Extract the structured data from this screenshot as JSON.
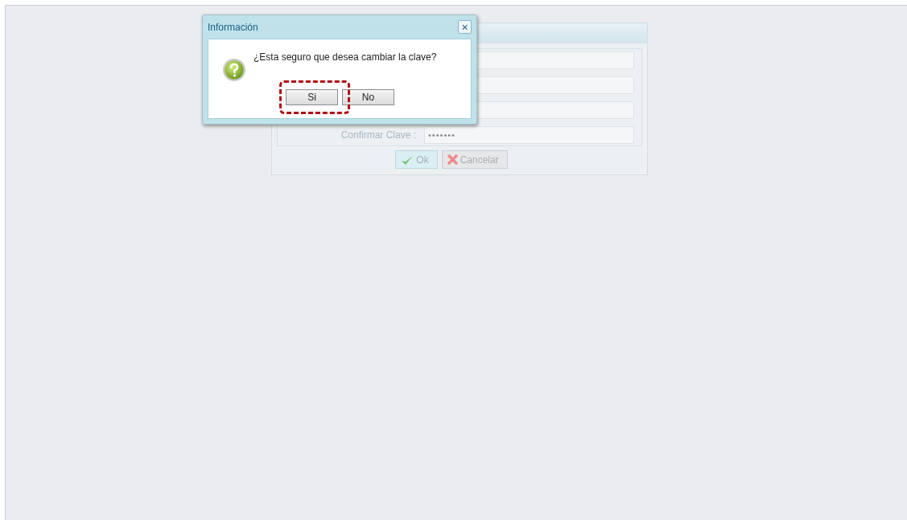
{
  "panel": {
    "fields": [
      {
        "kind": "empty"
      },
      {
        "kind": "empty"
      },
      {
        "kind": "empty"
      },
      {
        "kind": "password",
        "label": "Confirmar Clave :",
        "value": "•••••••"
      }
    ],
    "buttons": [
      {
        "kind": "ok",
        "label": "Ok"
      },
      {
        "kind": "cancel",
        "label": "Cancelar"
      }
    ]
  },
  "dialog": {
    "title": "Información",
    "close": "×",
    "message": "¿Esta seguro que desea cambiar la clave?",
    "buttons": [
      {
        "label": "Si",
        "highlighted": true
      },
      {
        "label": "No",
        "highlighted": false
      }
    ]
  }
}
